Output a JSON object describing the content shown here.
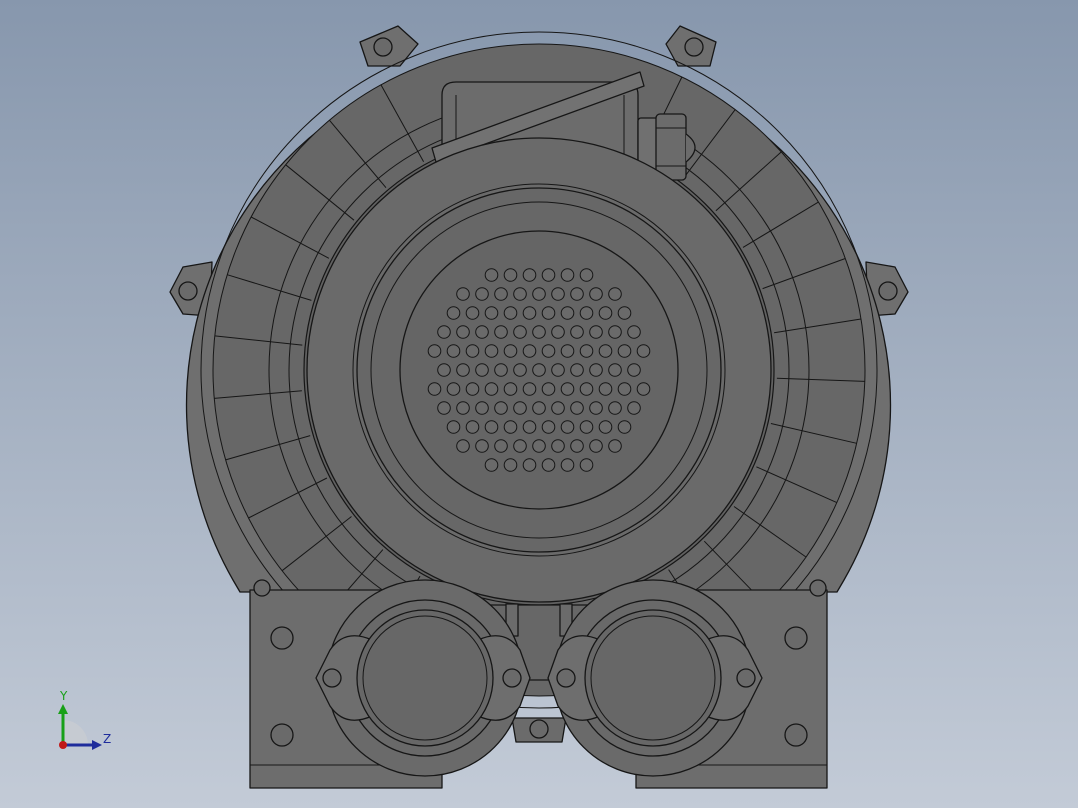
{
  "viewport": {
    "background_top": "#8797ad",
    "background_bottom": "#c3cbd7",
    "model": {
      "part_type": "side-channel-blower",
      "body_color": "#6f6f6f",
      "shade_color": "#5a5a5a",
      "edge_color": "#161616"
    }
  },
  "triad": {
    "y_label": "Y",
    "z_label": "Z",
    "y_color": "#18a018",
    "z_color": "#1e2c9c",
    "x_color": "#c01818"
  }
}
